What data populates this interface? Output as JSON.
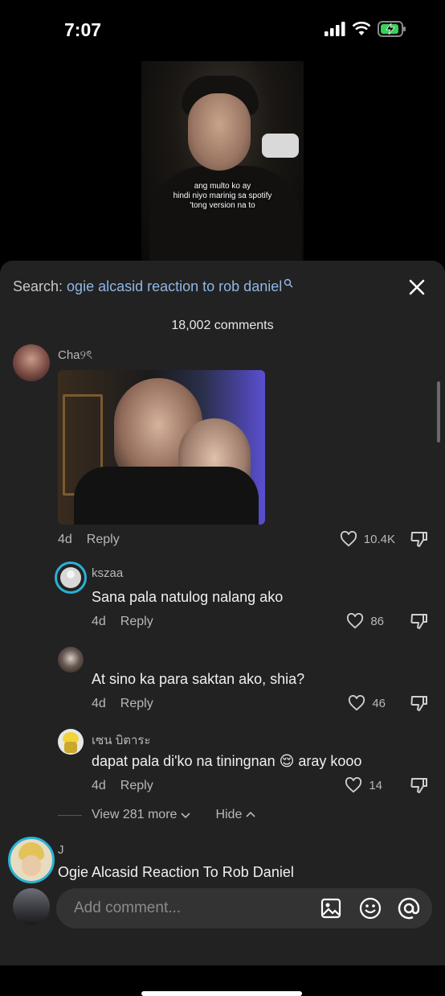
{
  "status": {
    "time": "7:07"
  },
  "video": {
    "caption_lines": [
      "ang multo ko ay",
      "hindi niyo marinig sa spotify",
      "'tong version na to"
    ]
  },
  "search": {
    "prefix": "Search: ",
    "query": "ogie alcasid reaction to rob daniel"
  },
  "comments_count": "18,002 comments",
  "comments": [
    {
      "user": "Cha୨ৎ",
      "age": "4d",
      "reply": "Reply",
      "likes": "10.4K"
    }
  ],
  "replies": [
    {
      "user": "kszaa",
      "text": "Sana pala natulog nalang ako",
      "age": "4d",
      "reply": "Reply",
      "likes": "86"
    },
    {
      "user": "",
      "text": "At sino ka para saktan ako, shia?",
      "age": "4d",
      "reply": "Reply",
      "likes": "46"
    },
    {
      "user": "เซน บิตาระ",
      "text": "dapat pala di'ko na tiningnan 😌 aray kooo",
      "age": "4d",
      "reply": "Reply",
      "likes": "14"
    }
  ],
  "thread_controls": {
    "view_more": "View 281 more",
    "hide": "Hide"
  },
  "next_comment": {
    "user": "J",
    "text": "Ogie Alcasid Reaction To Rob Daniel"
  },
  "composer": {
    "placeholder": "Add comment..."
  },
  "colors": {
    "sheet_bg": "#222222",
    "query_color": "#8fb7e6",
    "text_muted": "#b8b8b8"
  }
}
